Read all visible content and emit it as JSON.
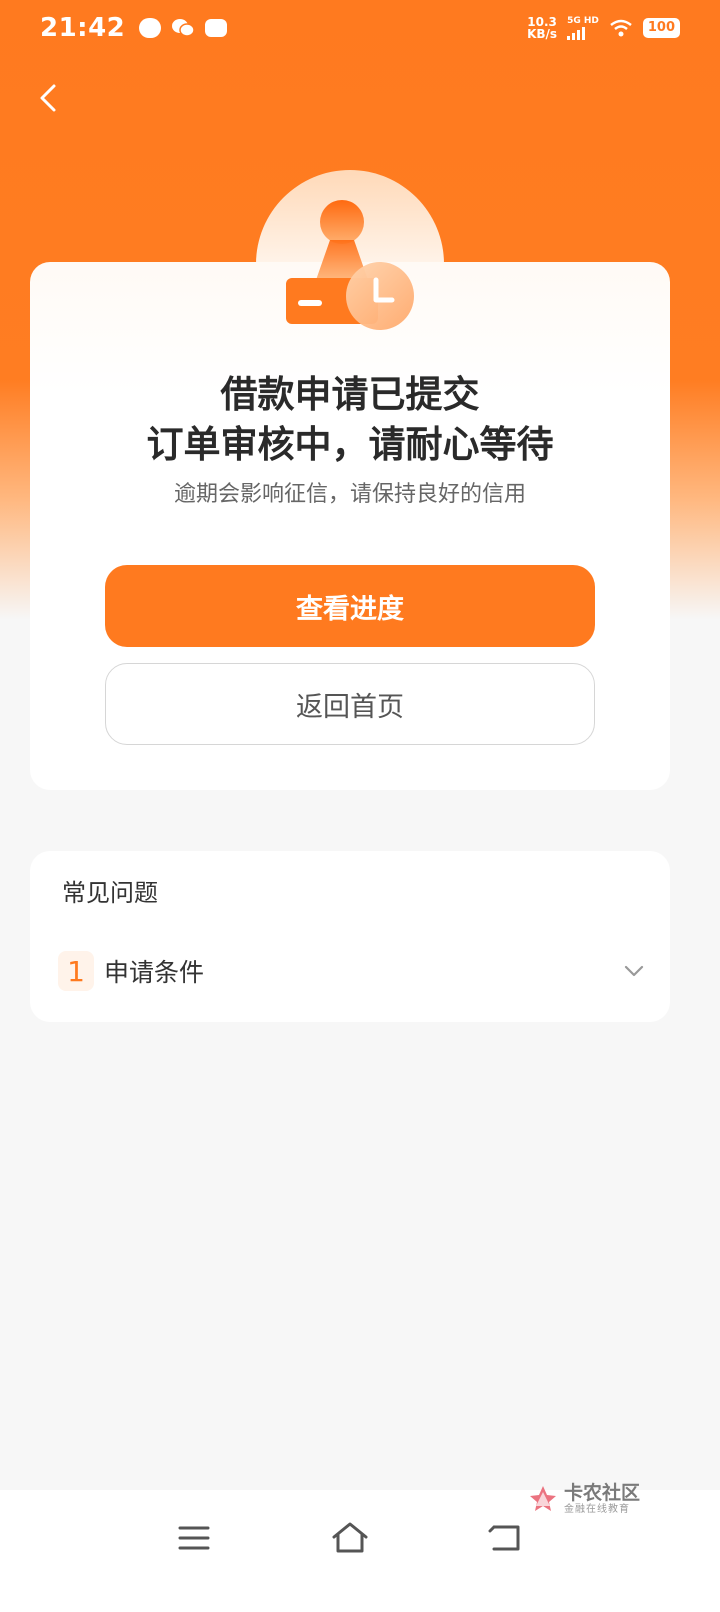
{
  "status_bar": {
    "time": "21:42",
    "net_speed_value": "10.3",
    "net_speed_unit": "KB/s",
    "network_type": "5G HD",
    "battery": "100",
    "icons": [
      "message-icon",
      "wechat-icon",
      "robot-icon",
      "signal-icon",
      "wifi-icon",
      "battery-icon"
    ]
  },
  "header": {
    "back_icon": "chevron-left-icon"
  },
  "result": {
    "title_line1": "借款申请已提交",
    "title_line2": "订单审核中，请耐心等待",
    "subtitle": "逾期会影响征信，请保持良好的信用",
    "illustration": "stamp-clock-icon"
  },
  "actions": {
    "primary_label": "查看进度",
    "secondary_label": "返回首页"
  },
  "faq": {
    "title": "常见问题",
    "items": [
      {
        "number": "1",
        "label": "申请条件"
      }
    ]
  },
  "nav_bar": {
    "icons": [
      "menu-icon",
      "home-icon",
      "back-icon"
    ]
  },
  "watermark": {
    "title": "卡农社区",
    "subtitle": "金融在线教育"
  },
  "colors": {
    "accent": "#ff7a1f",
    "background": "#f7f7f7"
  }
}
